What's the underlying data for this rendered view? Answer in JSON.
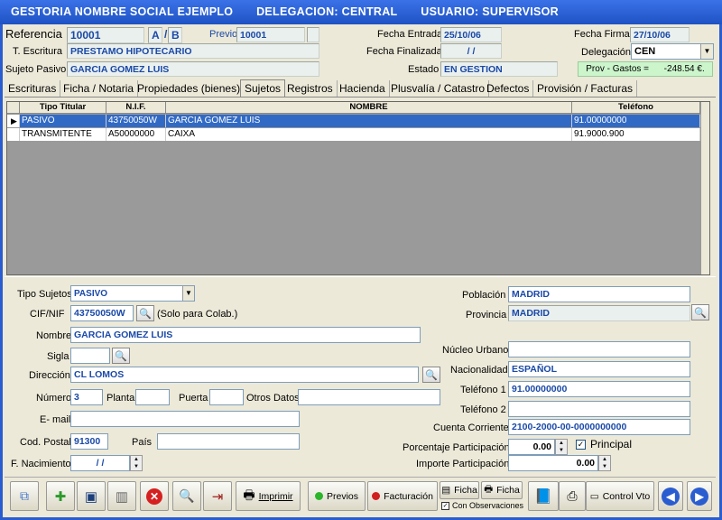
{
  "titlebar": {
    "org": "GESTORIA NOMBRE SOCIAL EJEMPLO",
    "deleg": "DELEGACION:  CENTRAL",
    "user": "USUARIO:  SUPERVISOR"
  },
  "header": {
    "referencia_label": "Referencia",
    "referencia": "10001",
    "serie1": "A",
    "slash": "/",
    "serie2": "B",
    "previo_label": "Previo",
    "previo": "10001",
    "fecha_entrada_label": "Fecha Entrada",
    "fecha_entrada": "25/10/06",
    "fecha_firma_label": "Fecha Firma",
    "fecha_firma": "27/10/06",
    "escritura_label": "T. Escritura",
    "escritura": "PRESTAMO HIPOTECARIO",
    "fecha_finalizada_label": "Fecha Finalizada",
    "fecha_finalizada": "/  /",
    "delegacion_label": "Delegación",
    "delegacion": "CEN",
    "sujeto_label": "Sujeto Pasivo",
    "sujeto": "GARCIA GOMEZ LUIS",
    "estado_label": "Estado",
    "estado": "EN GESTION",
    "prov_gastos": "Prov - Gastos =      -248.54 €."
  },
  "tabs": [
    "Escrituras",
    "Ficha / Notaria",
    "Propiedades (bienes)",
    "Sujetos",
    "Registros",
    "Hacienda",
    "Plusvalía / Catastro",
    "Defectos",
    "Provisión / Facturas"
  ],
  "grid": {
    "headers": [
      "Tipo Titular",
      "N.I.F.",
      "NOMBRE",
      "Teléfono"
    ],
    "rows": [
      [
        "PASIVO",
        "43750050W",
        "GARCIA GOMEZ LUIS",
        "91.00000000"
      ],
      [
        "TRANSMITENTE",
        "A50000000",
        "CAIXA",
        "91.9000.900"
      ]
    ]
  },
  "form": {
    "tipo_label": "Tipo Sujetos",
    "tipo": "PASIVO",
    "cif_label": "CIF/NIF",
    "cif": "43750050W",
    "solo": "(Solo para Colab.)",
    "nombre_label": "Nombre",
    "nombre": "GARCIA GOMEZ LUIS",
    "sigla_label": "Sigla",
    "sigla": "",
    "direccion_label": "Dirección",
    "direccion": "CL LOMOS",
    "numero_label": "Número",
    "numero": "3",
    "planta_label": "Planta",
    "puerta_label": "Puerta",
    "otros_label": "Otros Datos",
    "email_label": "E- mail",
    "cp_label": "Cod. Postal",
    "cp": "91300",
    "pais_label": "País",
    "nacimiento_label": "F. Nacimiento",
    "nacimiento": "/  /",
    "poblacion_label": "Población",
    "poblacion": "MADRID",
    "provincia_label": "Provincia",
    "provincia": "MADRID",
    "nucleo_label": "Núcleo Urbano",
    "nacionalidad_label": "Nacionalidad",
    "nacionalidad": "ESPAÑOL",
    "tel1_label": "Teléfono 1",
    "tel1": "91.00000000",
    "tel2_label": "Teléfono 2",
    "cuenta_label": "Cuenta Corriente",
    "cuenta": "2100-2000-00-0000000000",
    "porcentaje_label": "Porcentaje Participación",
    "porcentaje": "0.00",
    "principal_label": "Principal",
    "importe_label": "Importe Participación",
    "importe": "0.00"
  },
  "toolbar": {
    "imprimir": "Imprimir",
    "previos": "Previos",
    "facturacion": "Facturación",
    "ficha1": "Ficha",
    "ficha2": "Ficha",
    "con_obs": "Con Observaciones",
    "control_vto": "Control Vto"
  },
  "colors": {
    "accent": "#316ac5",
    "field_text": "#1a49a8",
    "titlebar": "#2a5dd0"
  }
}
